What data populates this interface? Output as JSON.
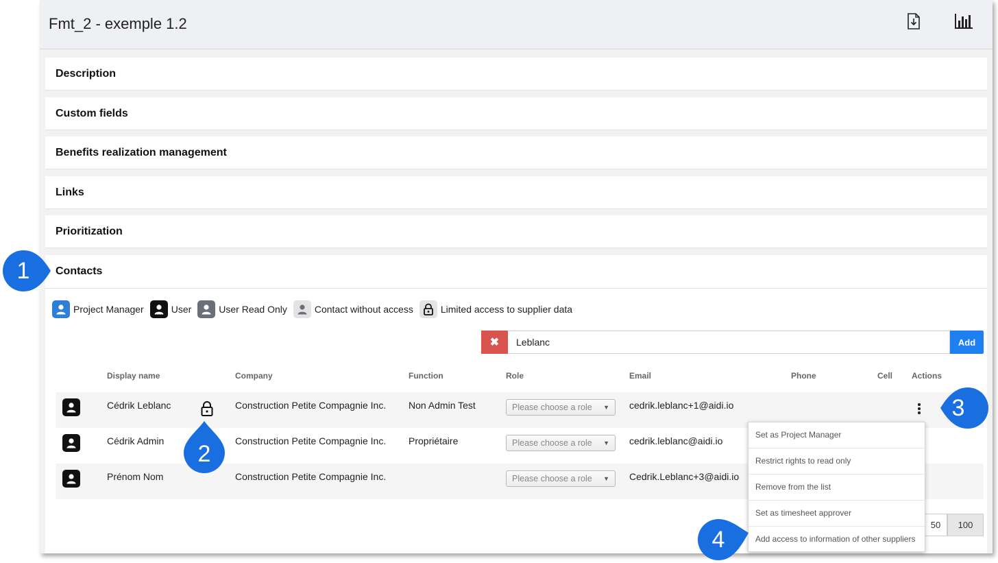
{
  "header": {
    "title": "Fmt_2 - exemple 1.2",
    "export_icon": "file-download-icon",
    "stats_icon": "bar-chart-icon"
  },
  "sections": [
    {
      "title": "Description"
    },
    {
      "title": "Custom fields"
    },
    {
      "title": "Benefits realization management"
    },
    {
      "title": "Links"
    },
    {
      "title": "Prioritization"
    }
  ],
  "contacts": {
    "title": "Contacts",
    "legend": [
      {
        "label": "Project Manager",
        "icon": "user-icon",
        "color": "#2f7fd6"
      },
      {
        "label": "User",
        "icon": "user-icon",
        "color": "#111111"
      },
      {
        "label": "User Read Only",
        "icon": "user-icon",
        "color": "#6b7078"
      },
      {
        "label": "Contact without access",
        "icon": "user-icon",
        "color": "#e3e3e3"
      },
      {
        "label": "Limited access to supplier data",
        "icon": "lock-icon",
        "color": "#e3e3e3"
      }
    ],
    "search": {
      "value": "Leblanc",
      "clear_icon": "close-icon",
      "add_label": "Add"
    },
    "columns": {
      "display_name": "Display name",
      "company": "Company",
      "function": "Function",
      "role": "Role",
      "email": "Email",
      "phone": "Phone",
      "cell": "Cell",
      "actions": "Actions"
    },
    "rows": [
      {
        "name": "Cédrik Leblanc",
        "company": "Construction Petite Compagnie Inc.",
        "function": "Non Admin Test",
        "role_placeholder": "Please choose a role",
        "email": "cedrik.leblanc+1@aidi.io",
        "limited": true
      },
      {
        "name": "Cédrik Admin",
        "company": "Construction Petite Compagnie Inc.",
        "function": "Propriétaire",
        "role_placeholder": "Please choose a role",
        "email": "cedrik.leblanc@aidi.io",
        "limited": false
      },
      {
        "name": "Prénom Nom",
        "company": "Construction Petite Compagnie Inc.",
        "function": "",
        "role_placeholder": "Please choose a role",
        "email": "Cedrik.Leblanc+3@aidi.io",
        "limited": false
      }
    ],
    "actions_menu": [
      "Set as Project Manager",
      "Restrict rights to read only",
      "Remove from the list",
      "Set as timesheet approver",
      "Add access to information of other suppliers"
    ],
    "page_sizes": [
      "50",
      "100"
    ],
    "active_page_size": "100"
  },
  "callouts": [
    "1",
    "2",
    "3",
    "4"
  ],
  "colors": {
    "accent": "#1e7ff0",
    "callout": "#1a6fe0",
    "danger": "#d9534f"
  }
}
